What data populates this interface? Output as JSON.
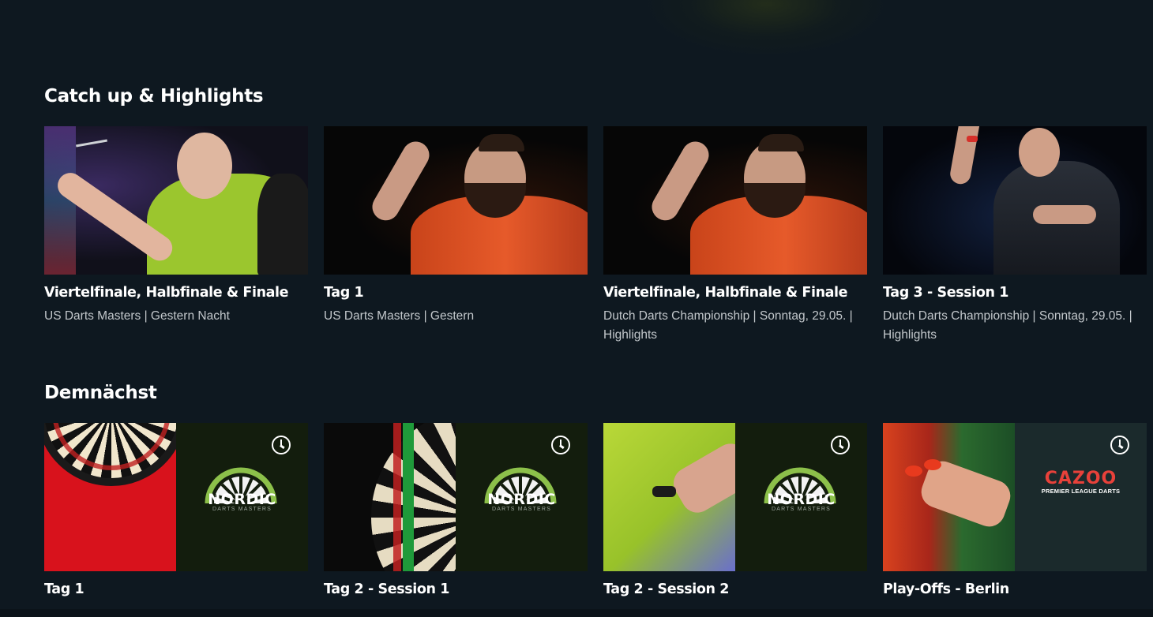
{
  "sections": {
    "catchup": {
      "title": "Catch up & Highlights",
      "cards": [
        {
          "title": "Viertelfinale, Halbfinale & Finale",
          "subtitle": "US Darts Masters | Gestern Nacht"
        },
        {
          "title": "Tag 1",
          "subtitle": "US Darts Masters | Gestern"
        },
        {
          "title": "Viertelfinale, Halbfinale & Finale",
          "subtitle": "Dutch Darts Championship | Sonntag, 29.05. | Highlights"
        },
        {
          "title": "Tag 3 - Session 1",
          "subtitle": "Dutch Darts Championship | Sonntag, 29.05. | Highlights"
        }
      ]
    },
    "upcoming": {
      "title": "Demnächst",
      "cards": [
        {
          "title": "Tag 1",
          "logo_text": "NORDIC",
          "logo_sub": "DARTS MASTERS",
          "icon": "clock-icon"
        },
        {
          "title": "Tag 2 - Session 1",
          "logo_text": "NORDIC",
          "logo_sub": "DARTS MASTERS",
          "icon": "clock-icon"
        },
        {
          "title": "Tag 2 - Session 2",
          "logo_text": "NORDIC",
          "logo_sub": "DARTS MASTERS",
          "icon": "clock-icon"
        },
        {
          "title": "Play-Offs - Berlin",
          "logo_text": "CAZOO",
          "logo_sub": "PREMIER LEAGUE DARTS",
          "icon": "clock-icon"
        }
      ]
    }
  },
  "colors": {
    "background": "#0e1820",
    "subtitle": "#c3c8cc",
    "nordic_green": "#8cc04a",
    "cazoo_red": "#e8413a"
  }
}
